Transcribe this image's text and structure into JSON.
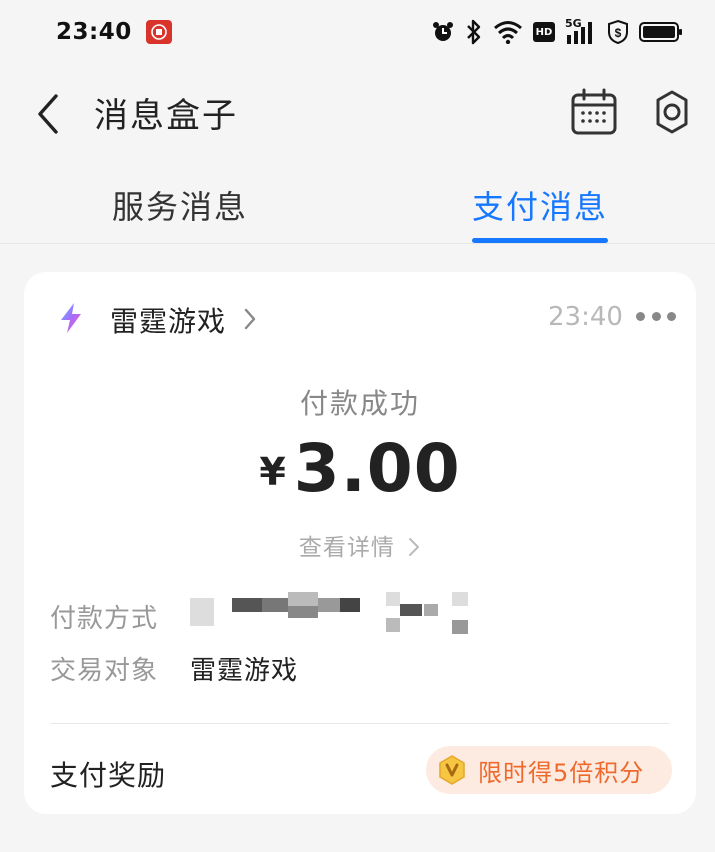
{
  "status_bar": {
    "time": "23:40",
    "network_label": "5G",
    "hd_label": "HD"
  },
  "header": {
    "title": "消息盒子",
    "icons": [
      "back-arrow-icon",
      "calendar-icon",
      "gear-icon"
    ]
  },
  "tabs": [
    {
      "label": "服务消息",
      "active": false
    },
    {
      "label": "支付消息",
      "active": true
    }
  ],
  "card": {
    "merchant": "雷霆游戏",
    "time": "23:40",
    "status": "付款成功",
    "currency": "¥",
    "amount": "3.00",
    "detail_link": "查看详情",
    "rows": {
      "payment_method_label": "付款方式",
      "trade_object_label": "交易对象",
      "trade_object_value": "雷霆游戏"
    },
    "reward_label": "支付奖励",
    "reward_badge": "限时得5倍积分"
  },
  "colors": {
    "accent": "#1677ff",
    "reward_orange": "#ee6a2c",
    "reward_bg": "#fdebe1"
  }
}
